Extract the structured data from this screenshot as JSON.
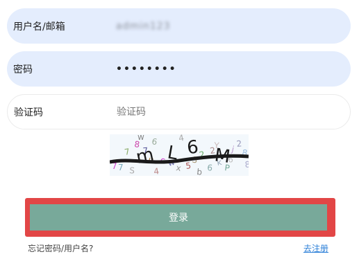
{
  "form": {
    "username_label": "用户名/邮箱",
    "username_value": "admin123",
    "password_label": "密码",
    "password_value": "••••••••",
    "captcha_label": "验证码",
    "captcha_placeholder": "验证码"
  },
  "captcha": {
    "text": "mL6M",
    "noise_chars": [
      "7",
      "8",
      "7",
      "u",
      "c",
      "w",
      "x",
      "5",
      "3",
      "2",
      "6",
      "k",
      "P",
      "j",
      "2",
      "8",
      "7",
      "S",
      "4",
      "Y",
      "7",
      "w",
      "4",
      "b",
      "2",
      "6",
      "6",
      "8"
    ],
    "colors": {
      "background": "#f3f8fc",
      "main_text": "#1a1a1a"
    }
  },
  "actions": {
    "login_label": "登录",
    "forgot_label": "忘记密码/用户名?",
    "register_label": "去注册"
  },
  "colors": {
    "input_filled_bg": "#e4edfd",
    "login_button_bg": "#78a99a",
    "highlight_border": "#e24646",
    "link": "#2b7fd8"
  }
}
